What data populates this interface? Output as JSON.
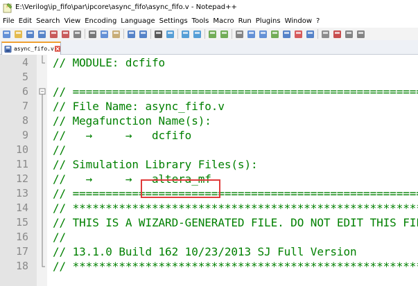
{
  "window": {
    "title": "E:\\Verilog\\ip_fifo\\par\\ipcore\\async_fifo\\async_fifo.v - Notepad++",
    "app_icon": "notepadpp-icon"
  },
  "menu": [
    "File",
    "Edit",
    "Search",
    "View",
    "Encoding",
    "Language",
    "Settings",
    "Tools",
    "Macro",
    "Run",
    "Plugins",
    "Window",
    "?"
  ],
  "toolbar": {
    "buttons": [
      "new-file-icon",
      "open-file-icon",
      "save-icon",
      "save-all-icon",
      "close-icon",
      "close-all-icon",
      "print-icon",
      "cut-icon",
      "copy-icon",
      "paste-icon",
      "undo-icon",
      "redo-icon",
      "find-icon",
      "replace-icon",
      "zoom-in-icon",
      "zoom-out-icon",
      "sync-vertical-icon",
      "sync-horizontal-icon",
      "word-wrap-icon",
      "show-all-chars-icon",
      "indent-guide-icon",
      "language-icon",
      "doc-map-icon",
      "function-list-icon",
      "folder-workspace-icon",
      "monitoring-icon",
      "record-macro-icon",
      "stop-record-icon",
      "play-macro-icon"
    ]
  },
  "tab": {
    "label": "async_fifo.v",
    "status": "unsaved"
  },
  "editor": {
    "lines": [
      {
        "num": "4",
        "text": "// MODULE: dcfifo",
        "fold": "end"
      },
      {
        "num": "5",
        "text": "",
        "fold": ""
      },
      {
        "num": "6",
        "text": "// ===================================================================",
        "fold": "start"
      },
      {
        "num": "7",
        "text": "// File Name: async_fifo.v",
        "fold": "line"
      },
      {
        "num": "8",
        "text": "// Megafunction Name(s):",
        "fold": "line"
      },
      {
        "num": "9",
        "text": "//   →     →   dcfifo",
        "fold": "line"
      },
      {
        "num": "10",
        "text": "//",
        "fold": "line"
      },
      {
        "num": "11",
        "text": "// Simulation Library Files(s):",
        "fold": "line"
      },
      {
        "num": "12",
        "text": "//   →     →   altera_mf",
        "fold": "line"
      },
      {
        "num": "13",
        "text": "// ===================================================================",
        "fold": "line"
      },
      {
        "num": "14",
        "text": "// *******************************************************************",
        "fold": "line"
      },
      {
        "num": "15",
        "text": "// THIS IS A WIZARD-GENERATED FILE. DO NOT EDIT THIS FILE!",
        "fold": "line"
      },
      {
        "num": "16",
        "text": "//",
        "fold": "line"
      },
      {
        "num": "17",
        "text": "// 13.1.0 Build 162 10/23/2013 SJ Full Version",
        "fold": "line"
      },
      {
        "num": "18",
        "text": "// *******************************************************************",
        "fold": "end"
      }
    ],
    "highlighted_text": "altera_mf",
    "colors": {
      "comment": "#008000",
      "line_number": "#8a8a8a",
      "gutter": "#e4e4e4",
      "highlight_box": "#e03a3a",
      "tab_accent": "#f0a030"
    }
  }
}
